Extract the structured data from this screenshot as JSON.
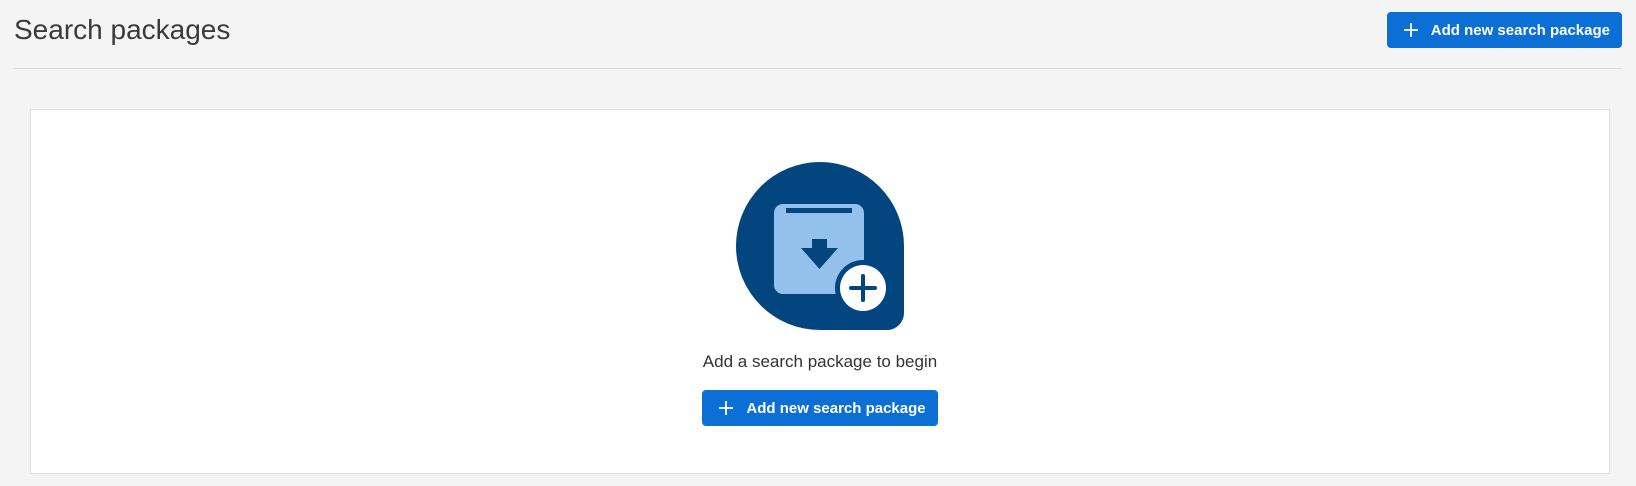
{
  "header": {
    "title": "Search packages",
    "add_button_label": "Add new search package"
  },
  "empty_state": {
    "illustration": "package-add-icon",
    "message": "Add a search package to begin",
    "add_button_label": "Add new search package"
  },
  "colors": {
    "page_background": "#f4f4f4",
    "primary_button": "#0b6fd6",
    "illustration_dark": "#03467f",
    "illustration_light": "#93c0ec"
  }
}
